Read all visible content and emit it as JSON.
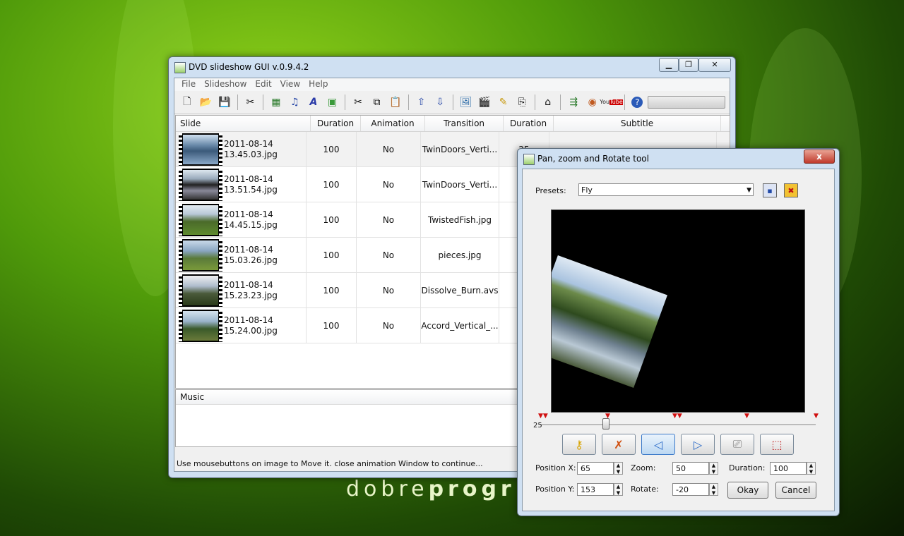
{
  "watermark": {
    "light": "dobre",
    "bold": "progr"
  },
  "main_window": {
    "title": "DVD slideshow GUI v.0.9.4.2",
    "menu": [
      "File",
      "Slideshow",
      "Edit",
      "View",
      "Help"
    ],
    "toolbar_icons": [
      "new-icon",
      "open-icon",
      "save-icon",
      "tools-icon",
      "add-image-icon",
      "add-audio-icon",
      "text-icon",
      "background-icon",
      "cut-icon",
      "copy-icon",
      "paste-icon",
      "up-arrow-icon",
      "down-arrow-icon",
      "image-icon",
      "clapper-icon",
      "pen-icon",
      "slideshow-icon",
      "projector-icon",
      "export-icon",
      "disc-icon",
      "youtube-icon",
      "help-icon"
    ],
    "columns": [
      "Slide",
      "Duration",
      "Animation",
      "Transition",
      "Duration",
      "Subtitle"
    ],
    "rows": [
      {
        "line1": "2011-08-14",
        "line2": "13.45.03.jpg",
        "duration": "100",
        "animation": "No",
        "transition": "TwinDoors_Verti...",
        "duration2": "25"
      },
      {
        "line1": "2011-08-14",
        "line2": "13.51.54.jpg",
        "duration": "100",
        "animation": "No",
        "transition": "TwinDoors_Verti...",
        "duration2": ""
      },
      {
        "line1": "2011-08-14",
        "line2": "14.45.15.jpg",
        "duration": "100",
        "animation": "No",
        "transition": "TwistedFish.jpg",
        "duration2": ""
      },
      {
        "line1": "2011-08-14",
        "line2": "15.03.26.jpg",
        "duration": "100",
        "animation": "No",
        "transition": "pieces.jpg",
        "duration2": ""
      },
      {
        "line1": "2011-08-14",
        "line2": "15.23.23.jpg",
        "duration": "100",
        "animation": "No",
        "transition": "Dissolve_Burn.avs",
        "duration2": ""
      },
      {
        "line1": "2011-08-14",
        "line2": "15.24.00.jpg",
        "duration": "100",
        "animation": "No",
        "transition": "Accord_Vertical_...",
        "duration2": ""
      }
    ],
    "music_label": "Music",
    "status": "Use mousebuttons on image to Move it. close animation Window to continue..."
  },
  "pz_window": {
    "title": "Pan, zoom and Rotate tool",
    "close_label": "x",
    "presets_label": "Presets:",
    "preset_value": "Fly",
    "slider_value": "25",
    "pos_x_label": "Position X:",
    "pos_x": "65",
    "pos_y_label": "Position Y:",
    "pos_y": "153",
    "zoom_label": "Zoom:",
    "zoom": "50",
    "rotate_label": "Rotate:",
    "rotate": "-20",
    "duration_label": "Duration:",
    "duration": "100",
    "okay_label": "Okay",
    "cancel_label": "Cancel"
  }
}
